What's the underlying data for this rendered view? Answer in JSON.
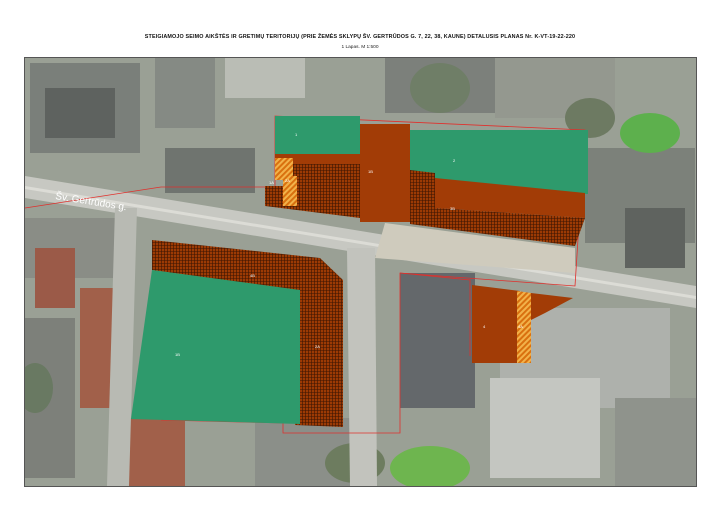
{
  "header": {
    "title": "STEIGIAMOJO SEIMO AIKŠTĖS IR GRETIMŲ TERITORIJŲ (PRIE ŽEMĖS SKLYPŲ ŠV. GERTRŪDOS G. 7, 22, 38, KAUNE) DETALUSIS PLANAS Nr. K-VT-19-22-220",
    "subtitle": "1 Lapas. M 1:500"
  },
  "map": {
    "street_label": "Šv. Gertrūdos g.",
    "colors": {
      "green_zone": "#2e9a6c",
      "brown_zone": "#a23c06",
      "hatched_zone": "#9c3a04",
      "orange_stripe": "#e88a1e",
      "boundary": "#e0302c"
    },
    "plot_labels": {
      "north_west_green": "1",
      "north_centre": "1B",
      "north_east_green": "2",
      "north_east_hatched": "3B",
      "west_small": "1A",
      "west_small_2": "2A",
      "south_west_green": "1B",
      "south_west_hatched": "2A",
      "south_west_top": "4B",
      "south_east": "4",
      "south_east_stripe": "4A"
    }
  }
}
